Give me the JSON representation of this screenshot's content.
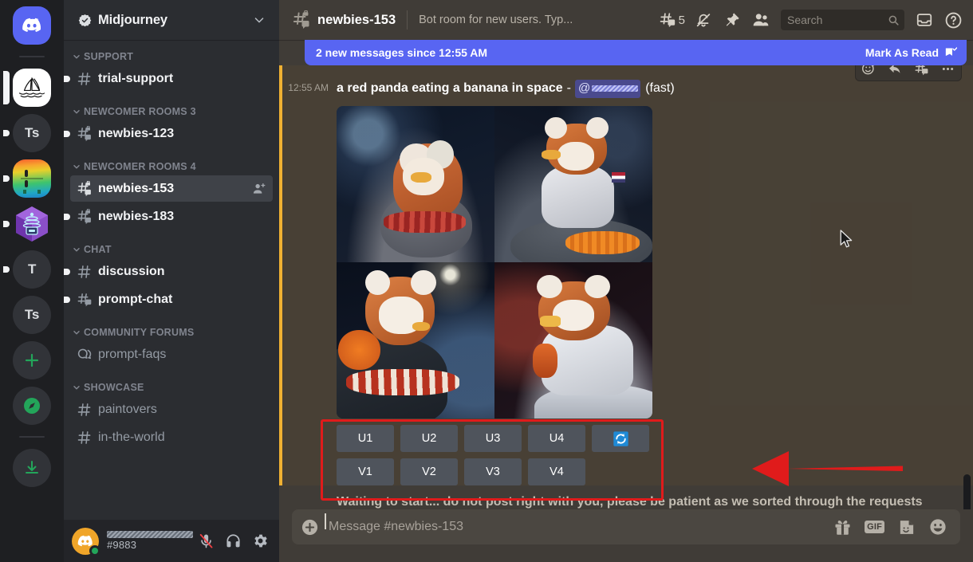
{
  "server_rail": {
    "items": [
      {
        "name": "discord-home",
        "label": "",
        "type": "discord",
        "badge": "none"
      },
      {
        "name": "server-midjourney",
        "label": "",
        "type": "midjourney",
        "badge": "tall",
        "active": true
      },
      {
        "name": "server-ts-1",
        "label": "Ts",
        "type": "text",
        "badge": "dot"
      },
      {
        "name": "server-gradient",
        "label": "",
        "type": "gradient",
        "badge": "dot"
      },
      {
        "name": "server-hex",
        "label": "",
        "type": "hex",
        "badge": "dot"
      },
      {
        "name": "server-t",
        "label": "T",
        "type": "text",
        "badge": "dot"
      },
      {
        "name": "server-ts-2",
        "label": "Ts",
        "type": "text",
        "badge": "none"
      },
      {
        "name": "add-server",
        "label": "",
        "type": "plus",
        "badge": "none"
      },
      {
        "name": "explore-servers",
        "label": "",
        "type": "compass",
        "badge": "none"
      },
      {
        "name": "download-apps",
        "label": "",
        "type": "download",
        "badge": "none"
      }
    ]
  },
  "sidebar": {
    "server_name": "Midjourney",
    "categories": [
      {
        "label": "SUPPORT",
        "channels": [
          {
            "label": "trial-support",
            "icon": "hash",
            "state": "unread"
          }
        ]
      },
      {
        "label": "NEWCOMER ROOMS 3",
        "channels": [
          {
            "label": "newbies-123",
            "icon": "hash-thread-locked",
            "state": "unread"
          }
        ]
      },
      {
        "label": "NEWCOMER ROOMS 4",
        "channels": [
          {
            "label": "newbies-153",
            "icon": "hash-thread-locked",
            "state": "selected",
            "action": "add-member-icon"
          },
          {
            "label": "newbies-183",
            "icon": "hash-thread-locked",
            "state": "unread"
          }
        ]
      },
      {
        "label": "CHAT",
        "channels": [
          {
            "label": "discussion",
            "icon": "hash",
            "state": "unread"
          },
          {
            "label": "prompt-chat",
            "icon": "hash-thread",
            "state": "unread"
          }
        ]
      },
      {
        "label": "COMMUNITY FORUMS",
        "channels": [
          {
            "label": "prompt-faqs",
            "icon": "forum",
            "state": "normal"
          }
        ]
      },
      {
        "label": "SHOWCASE",
        "channels": [
          {
            "label": "paintovers",
            "icon": "hash",
            "state": "normal"
          },
          {
            "label": "in-the-world",
            "icon": "hash",
            "state": "normal"
          }
        ]
      }
    ]
  },
  "user_panel": {
    "username_redacted": "",
    "discriminator": "#9883",
    "status": "online",
    "buttons": [
      {
        "name": "mic-muted-button",
        "label": "Mute"
      },
      {
        "name": "deafen-button",
        "label": "Deafen"
      },
      {
        "name": "user-settings-button",
        "label": "User Settings"
      }
    ]
  },
  "topbar": {
    "channel_name": "newbies-153",
    "topic": "Bot room for new users. Typ...",
    "thread_count": "5",
    "buttons": [
      {
        "name": "notifications-muted-icon",
        "label": "Notification Settings"
      },
      {
        "name": "pinned-messages-icon",
        "label": "Pinned Messages"
      },
      {
        "name": "member-list-icon",
        "label": "Show Member List"
      },
      {
        "name": "inbox-icon",
        "label": "Inbox"
      },
      {
        "name": "help-icon",
        "label": "Help"
      }
    ]
  },
  "search": {
    "placeholder": "Search"
  },
  "banner": {
    "text": "2 new messages since 12:55 AM",
    "action_label": "Mark As Read",
    "color": "#5865f2"
  },
  "message": {
    "timestamp": "12:55 AM",
    "prompt": "a red panda eating a banana in space",
    "separator": "-",
    "mention_at": "@",
    "mention_text": "",
    "suffix": "(fast)",
    "mention_bar_color": "#f0b132",
    "hover_actions": [
      {
        "name": "add-reaction-icon",
        "label": "Add Reaction"
      },
      {
        "name": "reply-icon",
        "label": "Reply"
      },
      {
        "name": "create-thread-icon",
        "label": "Create Thread"
      },
      {
        "name": "more-actions-icon",
        "label": "More"
      }
    ],
    "image_grid": {
      "alt": "four generated images of a red panda eating a banana in space",
      "rows": 2,
      "cols": 2
    },
    "buttons": {
      "row1": [
        "U1",
        "U2",
        "U3",
        "U4"
      ],
      "reroll": "reroll-icon",
      "row2": [
        "V1",
        "V2",
        "V3",
        "V4"
      ]
    },
    "next_message_preview": "Waiting to start... do not post right with you, please be patient as we sorted through the requests"
  },
  "annotation": {
    "rect_color": "#e01b1b",
    "arrow_color": "#e01b1b",
    "arrow_direction": "left"
  },
  "composer": {
    "placeholder": "Message #newbies-153",
    "buttons": [
      {
        "name": "upload-attachment-button",
        "label": "+"
      },
      {
        "name": "gift-button",
        "label": "Gift"
      },
      {
        "name": "gif-button",
        "label": "GIF"
      },
      {
        "name": "sticker-button",
        "label": "Sticker"
      },
      {
        "name": "emoji-button",
        "label": "Emoji"
      }
    ],
    "gif_label": "GIF"
  },
  "colors": {
    "rail_bg": "#1e1f22",
    "sidebar_bg": "#2b2d31",
    "main_bg": "#403c37",
    "accent": "#5865f2",
    "annotation_red": "#e01b1b"
  }
}
